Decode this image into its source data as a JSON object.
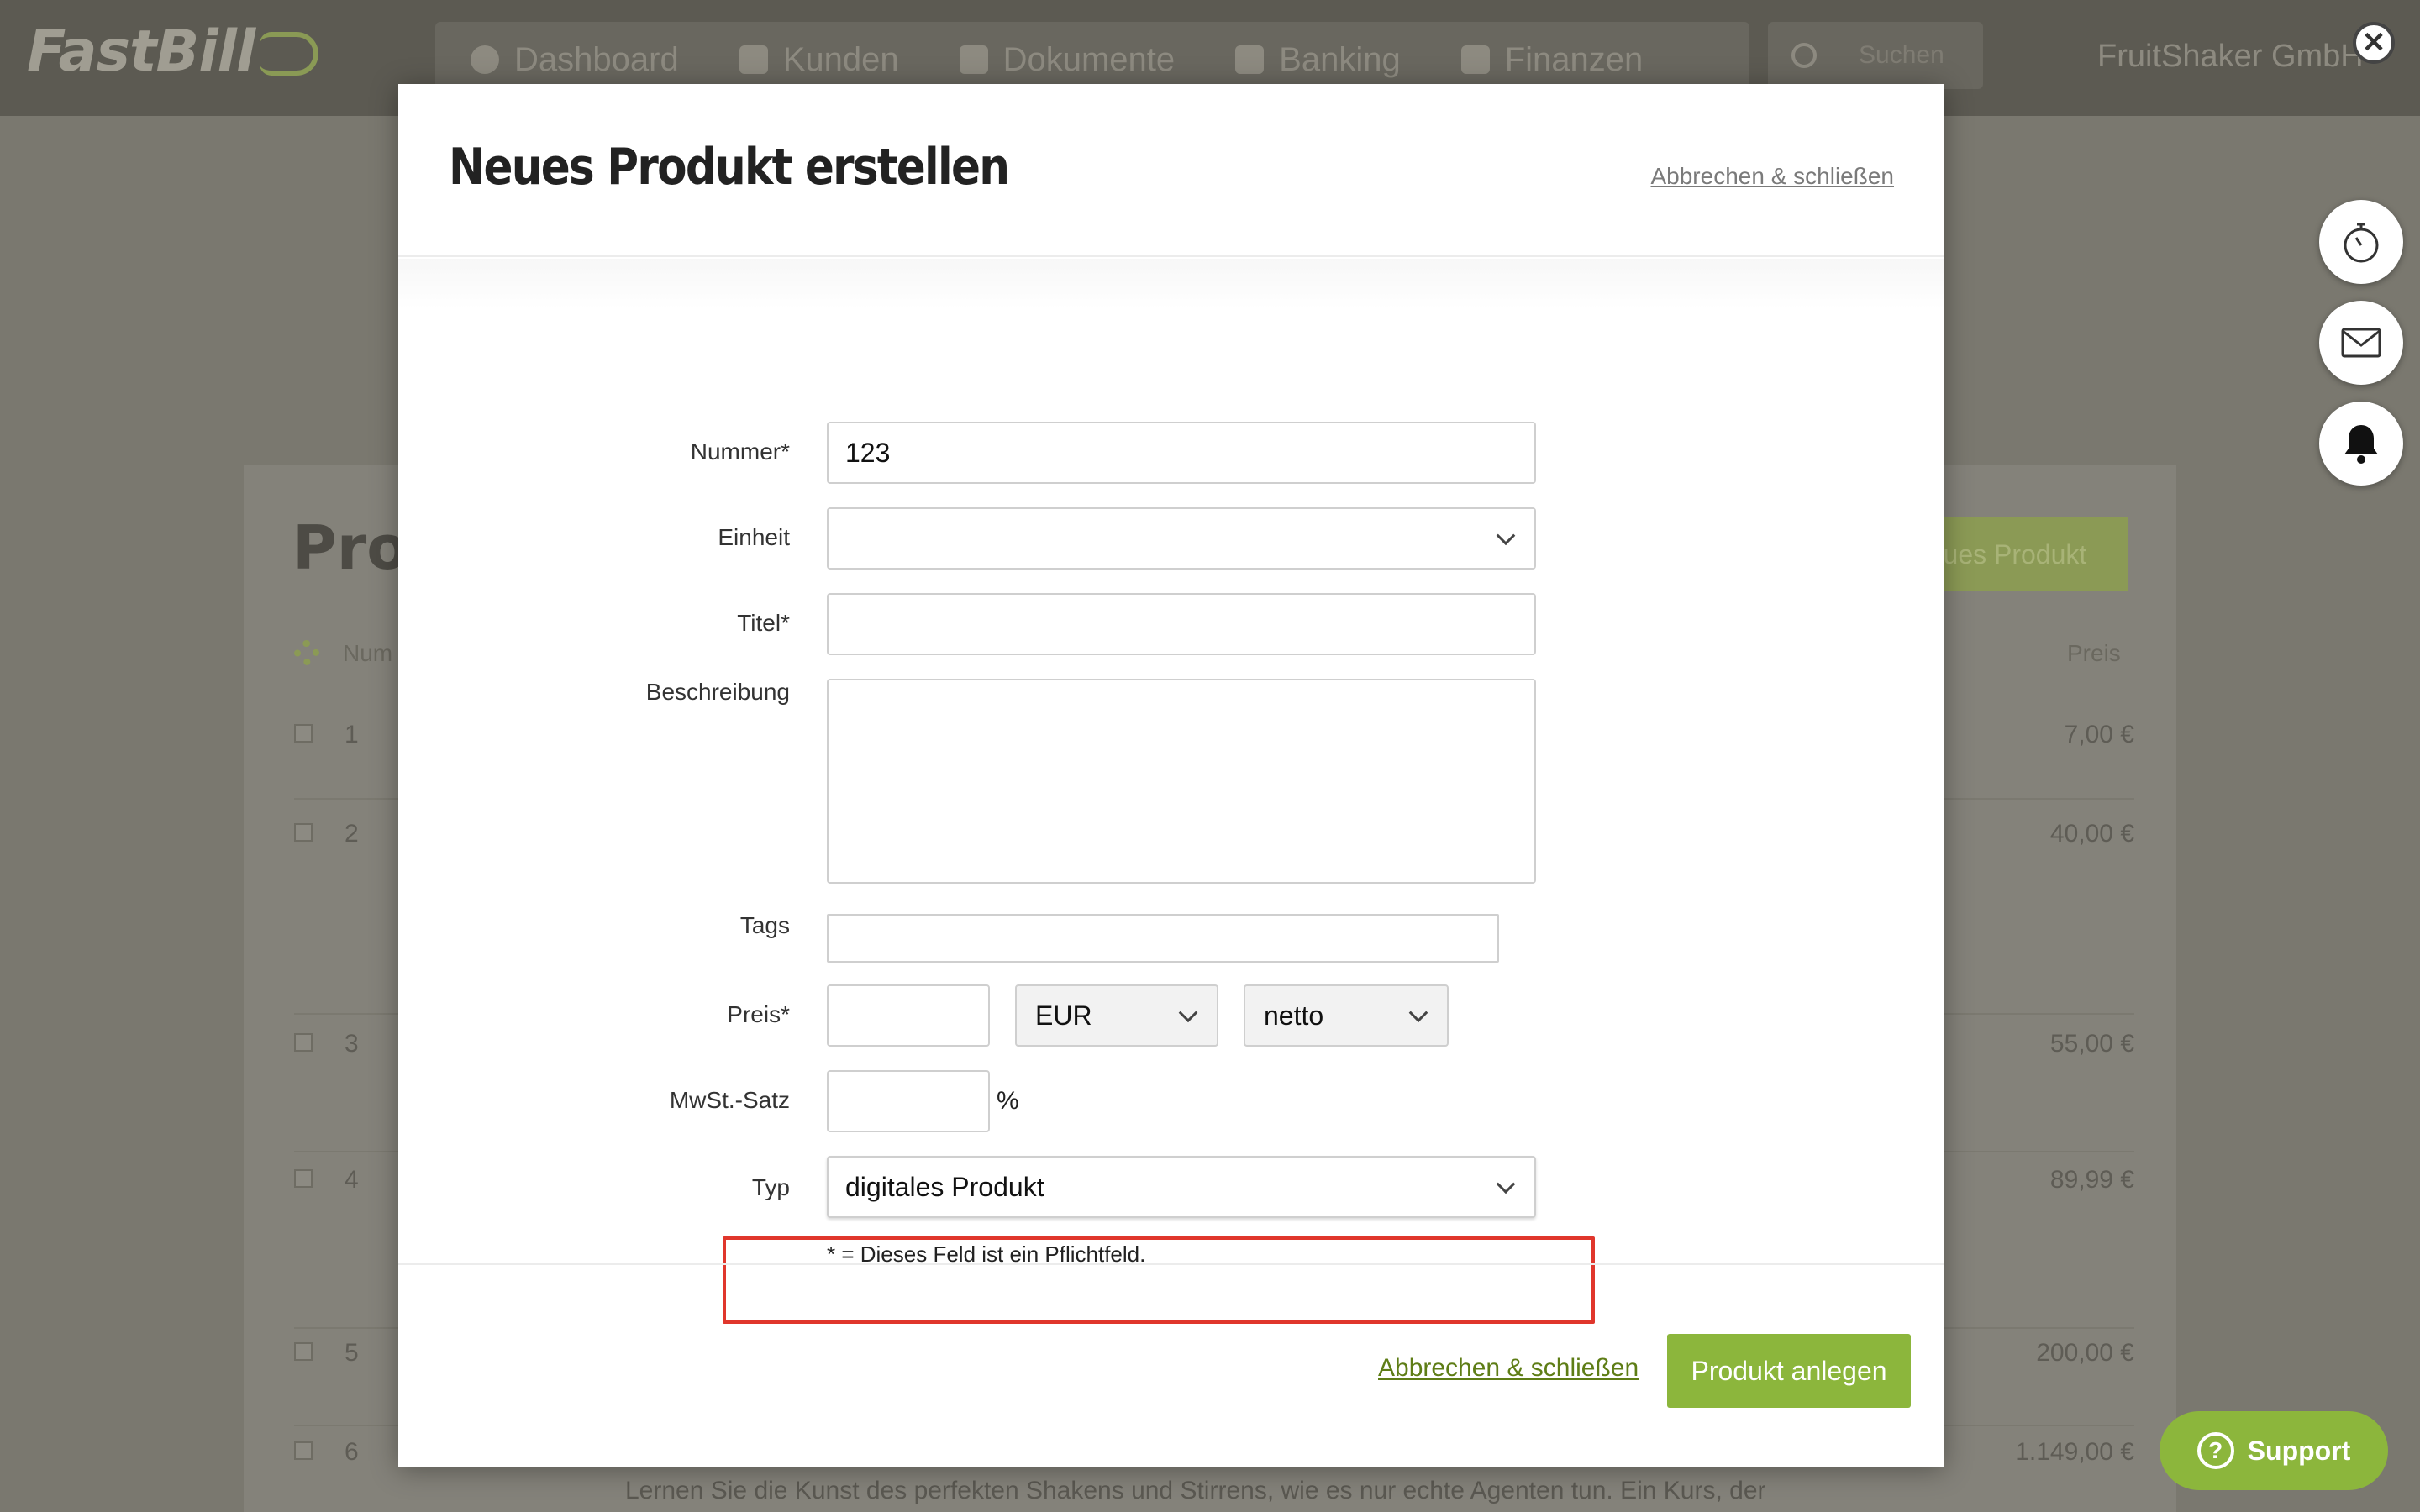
{
  "app": {
    "logo": "FastBill",
    "company": "FruitShaker GmbH",
    "nav": [
      {
        "label": "Dashboard",
        "icon": "info-icon"
      },
      {
        "label": "Kunden",
        "icon": "briefcase-icon"
      },
      {
        "label": "Dokumente",
        "icon": "document-icon"
      },
      {
        "label": "Banking",
        "icon": "bar-chart-icon"
      },
      {
        "label": "Finanzen",
        "icon": "transfer-icon"
      }
    ],
    "search_placeholder": "Suchen"
  },
  "background_page": {
    "title": "Prod",
    "new_button": "eues Produkt",
    "columns": {
      "number": "Num",
      "price": "Preis"
    },
    "rows": [
      {
        "number": "1",
        "price": "7,00 €"
      },
      {
        "number": "2",
        "price": "40,00 €"
      },
      {
        "number": "3",
        "price": "55,00 €"
      },
      {
        "number": "4",
        "price": "89,99 €"
      },
      {
        "number": "5",
        "price": "200,00 €"
      },
      {
        "number": "6",
        "price": "1.149,00 €"
      }
    ],
    "description_fragment": "Lernen Sie die Kunst des perfekten Shakens und Stirrens, wie es nur echte Agenten tun. Ein Kurs, der"
  },
  "side_buttons": [
    "stopwatch-icon",
    "mail-icon",
    "bell-icon"
  ],
  "support": {
    "label": "Support"
  },
  "modal": {
    "title": "Neues Produkt erstellen",
    "header_cancel": "Abbrechen & schließen",
    "fields": {
      "nummer": {
        "label": "Nummer*",
        "value": "123"
      },
      "einheit": {
        "label": "Einheit",
        "value": ""
      },
      "titel": {
        "label": "Titel*",
        "value": ""
      },
      "beschreibung": {
        "label": "Beschreibung",
        "value": ""
      },
      "tags": {
        "label": "Tags",
        "value": ""
      },
      "preis": {
        "label": "Preis*",
        "value": "",
        "currency": "EUR",
        "mode": "netto"
      },
      "mwst": {
        "label": "MwSt.-Satz",
        "value": "",
        "unit": "%"
      },
      "typ": {
        "label": "Typ",
        "value": "digitales Produkt"
      }
    },
    "required_note": "* = Dieses Feld ist ein Pflichtfeld.",
    "footer_cancel": "Abbrechen & schließen",
    "submit": "Produkt anlegen"
  },
  "colors": {
    "accent": "#8cb63c",
    "highlight": "#e0362c"
  }
}
